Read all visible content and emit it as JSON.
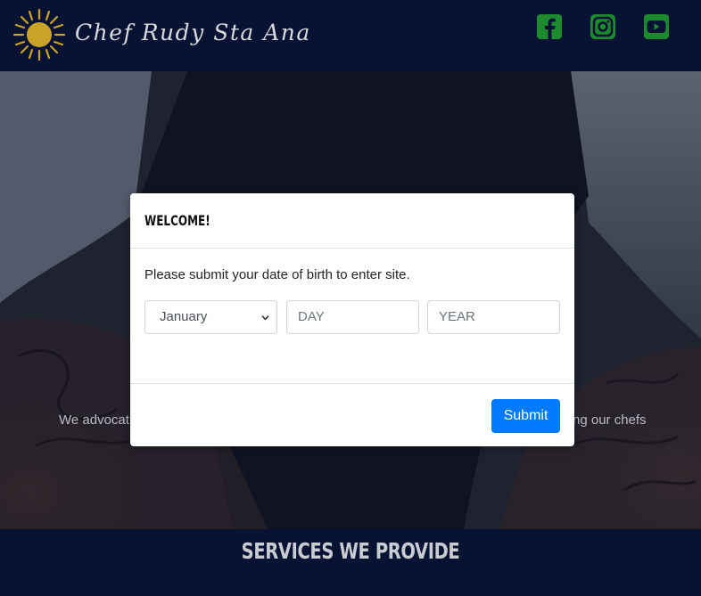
{
  "header": {
    "brand": "Chef Rudy Sta Ana",
    "logo_icon": "sun-icon",
    "social": [
      {
        "name": "facebook-icon",
        "color": "#1e8a2e"
      },
      {
        "name": "instagram-icon",
        "color": "#1e8a2e"
      },
      {
        "name": "youtube-icon",
        "color": "#1e8a2e"
      }
    ]
  },
  "hero": {
    "text_left": "We advocat",
    "text_right": "ng our chefs"
  },
  "services": {
    "title": "SERVICES WE PROVIDE"
  },
  "modal": {
    "title": "WELCOME!",
    "prompt": "Please submit your date of birth to enter site.",
    "month_value": "January",
    "day_placeholder": "DAY",
    "year_placeholder": "YEAR",
    "submit_label": "Submit"
  },
  "colors": {
    "navbar": "#081233",
    "accent_blue": "#007bff",
    "social_green": "#1e8a2e",
    "logo_gold": "#c9a227"
  }
}
